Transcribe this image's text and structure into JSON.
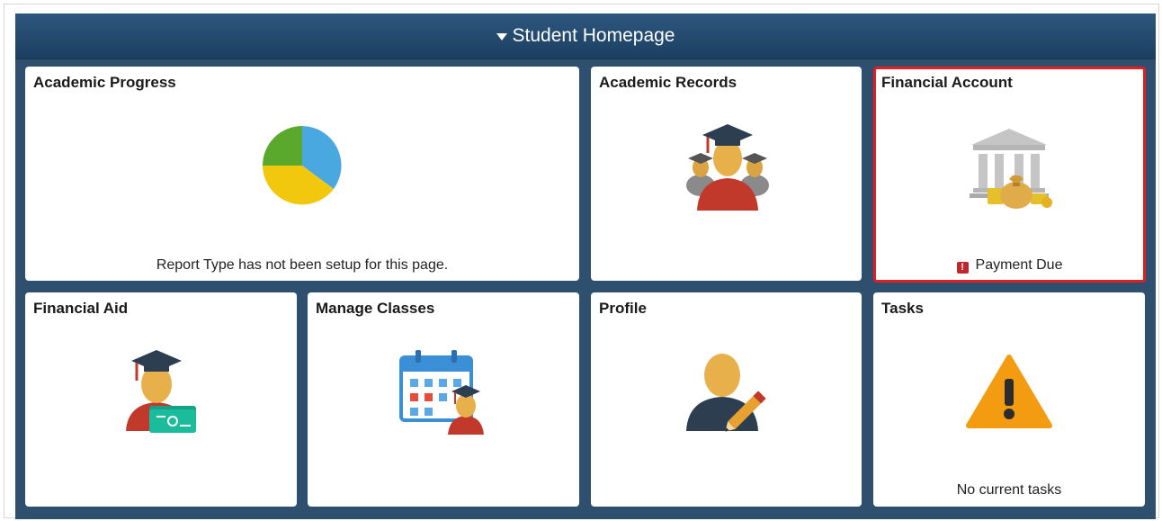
{
  "header": {
    "title": "Student Homepage"
  },
  "tiles": {
    "academic_progress": {
      "title": "Academic Progress",
      "footer": "Report Type has not been setup for this page."
    },
    "academic_records": {
      "title": "Academic Records"
    },
    "financial_account": {
      "title": "Financial Account",
      "alert_icon": "!",
      "footer": "Payment Due"
    },
    "financial_aid": {
      "title": "Financial Aid"
    },
    "manage_classes": {
      "title": "Manage Classes"
    },
    "profile": {
      "title": "Profile"
    },
    "tasks": {
      "title": "Tasks",
      "footer": "No current tasks"
    }
  },
  "icons": {
    "academic_progress": "pie-chart-icon",
    "academic_records": "graduates-icon",
    "financial_account": "bank-icon",
    "financial_aid": "graduate-money-icon",
    "manage_classes": "calendar-student-icon",
    "profile": "profile-edit-icon",
    "tasks": "warning-icon"
  },
  "colors": {
    "header_bg": "#1f4568",
    "page_bg": "#2f4f6f",
    "selected_border": "#e02020",
    "alert": "#c0272d"
  }
}
